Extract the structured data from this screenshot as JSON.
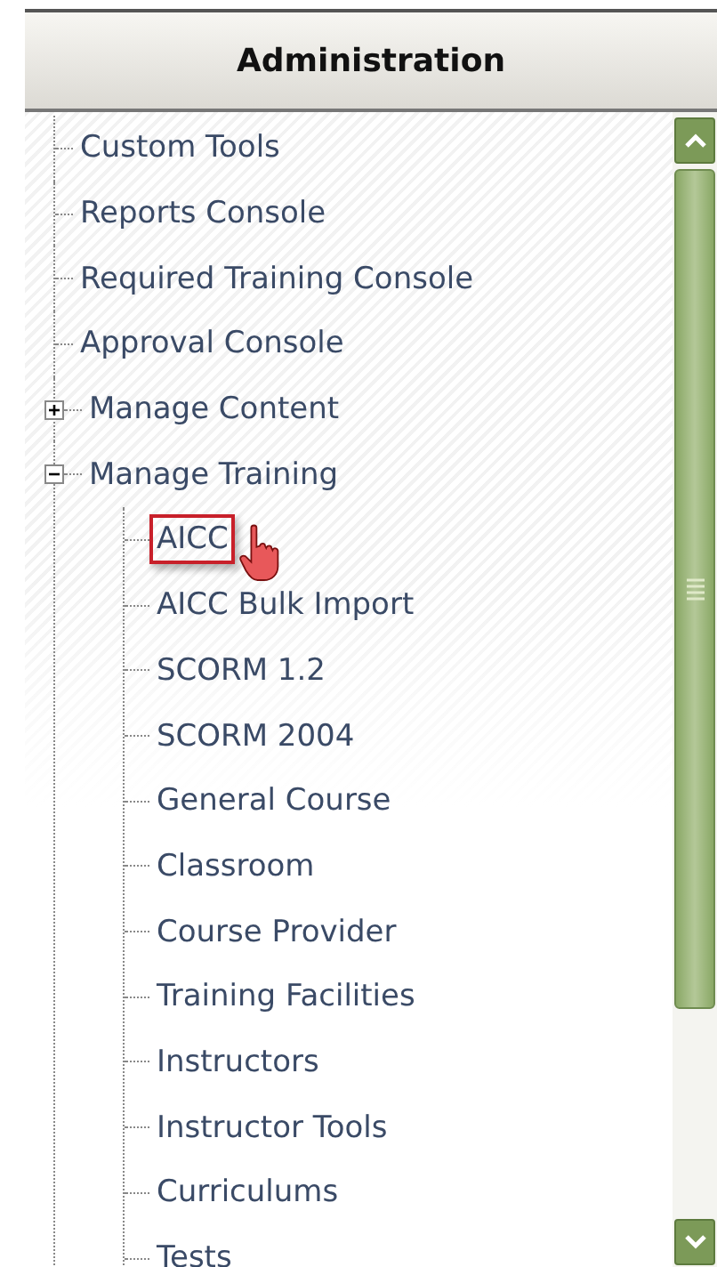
{
  "panel": {
    "title": "Administration"
  },
  "tree": [
    {
      "label": "Custom Tools"
    },
    {
      "label": "Reports Console"
    },
    {
      "label": "Required Training Console"
    },
    {
      "label": "Approval Console"
    },
    {
      "label": "Manage Content",
      "expanded": false
    },
    {
      "label": "Manage Training",
      "expanded": true,
      "children": [
        {
          "label": "AICC",
          "selected": true
        },
        {
          "label": "AICC Bulk Import",
          "selected": false
        },
        {
          "label": "SCORM 1.2",
          "selected": false
        },
        {
          "label": "SCORM 2004",
          "selected": false
        },
        {
          "label": "General Course",
          "selected": false
        },
        {
          "label": "Classroom",
          "selected": false
        },
        {
          "label": "Course Provider",
          "selected": false
        },
        {
          "label": "Training Facilities",
          "selected": false
        },
        {
          "label": "Instructors",
          "selected": false
        },
        {
          "label": "Instructor Tools",
          "selected": false
        },
        {
          "label": "Curriculums",
          "selected": false
        },
        {
          "label": "Tests",
          "selected": false
        }
      ]
    }
  ]
}
